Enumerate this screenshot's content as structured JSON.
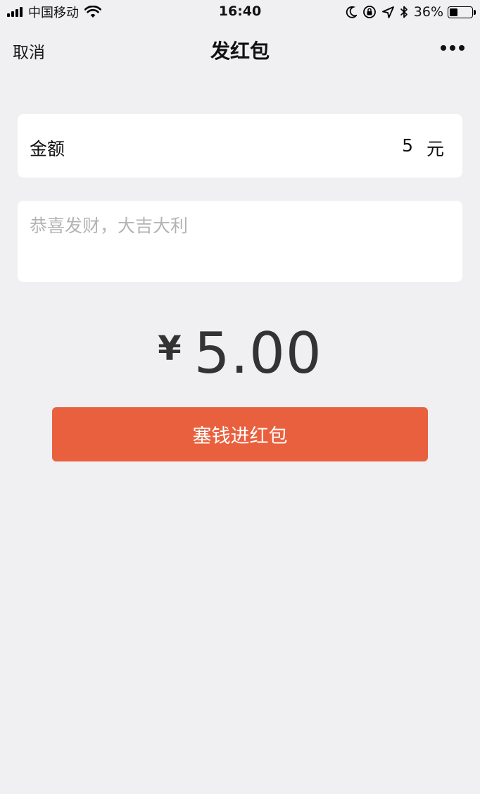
{
  "status_bar": {
    "carrier": "中国移动",
    "time": "16:40",
    "battery_percent_text": "36%",
    "battery_level": 0.36,
    "icons": [
      "signal-icon",
      "wifi-icon",
      "moon-icon",
      "rotation-lock-icon",
      "location-icon",
      "bluetooth-icon",
      "battery-icon"
    ]
  },
  "nav": {
    "cancel_label": "取消",
    "title": "发红包",
    "more_icon": "more-dots-icon"
  },
  "amount": {
    "label": "金额",
    "value": "5",
    "unit": "元"
  },
  "message": {
    "placeholder": "恭喜发财，大吉大利",
    "value": ""
  },
  "total": {
    "currency_symbol": "¥",
    "value": "5.00"
  },
  "submit": {
    "label": "塞钱进红包"
  },
  "colors": {
    "accent": "#e9603e",
    "background": "#f0eff1",
    "card": "#ffffff",
    "placeholder": "#b3b3b3",
    "total_text": "#333333"
  }
}
